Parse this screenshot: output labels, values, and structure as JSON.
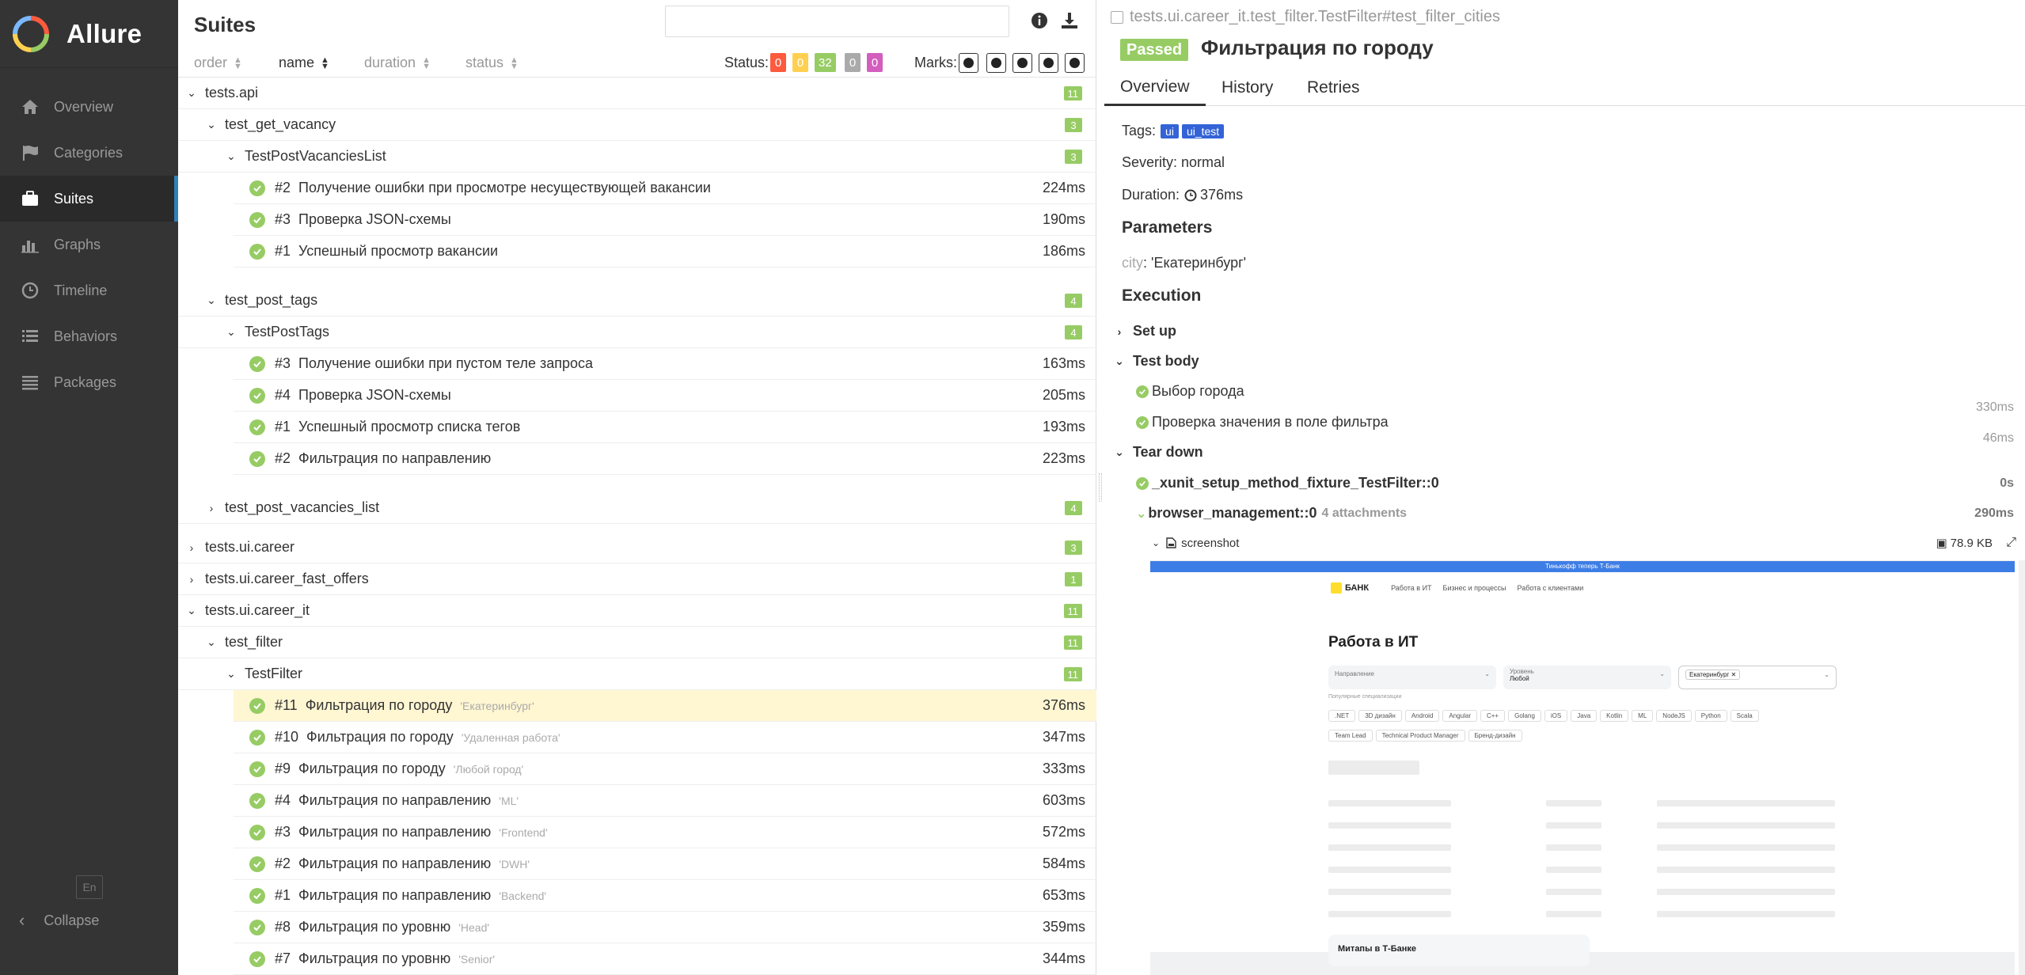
{
  "app": {
    "name": "Allure"
  },
  "sidebar": {
    "items": [
      {
        "label": "Overview",
        "icon": "home-icon"
      },
      {
        "label": "Categories",
        "icon": "flag-icon"
      },
      {
        "label": "Suites",
        "icon": "briefcase-icon",
        "active": true
      },
      {
        "label": "Graphs",
        "icon": "bar-chart-icon"
      },
      {
        "label": "Timeline",
        "icon": "clock-icon"
      },
      {
        "label": "Behaviors",
        "icon": "list-icon"
      },
      {
        "label": "Packages",
        "icon": "align-left-icon"
      }
    ],
    "lang": "En",
    "collapse": "Collapse"
  },
  "suites": {
    "title": "Suites",
    "sort": {
      "order": "order",
      "name": "name",
      "duration": "duration",
      "status": "status"
    },
    "status_label": "Status:",
    "status_counts": [
      {
        "value": "0",
        "color": "#fd5a3e"
      },
      {
        "value": "0",
        "color": "#ffd050"
      },
      {
        "value": "32",
        "color": "#97cc64"
      },
      {
        "value": "0",
        "color": "#aaaaaa"
      },
      {
        "value": "0",
        "color": "#d35ebe"
      }
    ],
    "marks_label": "Marks:",
    "rows": [
      {
        "level": 0,
        "chev": "v",
        "label": "tests.api",
        "count": "11"
      },
      {
        "level": 1,
        "chev": "v",
        "label": "test_get_vacancy",
        "count": "3"
      },
      {
        "level": 2,
        "chev": "v",
        "label": "TestPostVacanciesList",
        "count": "3"
      },
      {
        "level": 3,
        "num": "#2",
        "label": "Получение ошибки при просмотре несуществующей вакансии",
        "dur": "224ms"
      },
      {
        "level": 3,
        "num": "#3",
        "label": "Проверка JSON-схемы",
        "dur": "190ms"
      },
      {
        "level": 3,
        "num": "#1",
        "label": "Успешный просмотр вакансии",
        "dur": "186ms"
      },
      {
        "level": 1,
        "chev": "v",
        "label": "test_post_tags",
        "count": "4"
      },
      {
        "level": 2,
        "chev": "v",
        "label": "TestPostTags",
        "count": "4"
      },
      {
        "level": 3,
        "num": "#3",
        "label": "Получение ошибки при пустом теле запроса",
        "dur": "163ms"
      },
      {
        "level": 3,
        "num": "#4",
        "label": "Проверка JSON-схемы",
        "dur": "205ms"
      },
      {
        "level": 3,
        "num": "#1",
        "label": "Успешный просмотр списка тегов",
        "dur": "193ms"
      },
      {
        "level": 3,
        "num": "#2",
        "label": "Фильтрация по направлению",
        "dur": "223ms"
      },
      {
        "level": 1,
        "chev": ">",
        "label": "test_post_vacancies_list",
        "count": "4"
      },
      {
        "level": 0,
        "chev": ">",
        "label": "tests.ui.career",
        "count": "3"
      },
      {
        "level": 0,
        "chev": ">",
        "label": "tests.ui.career_fast_offers",
        "count": "1"
      },
      {
        "level": 0,
        "chev": "v",
        "label": "tests.ui.career_it",
        "count": "11"
      },
      {
        "level": 1,
        "chev": "v",
        "label": "test_filter",
        "count": "11"
      },
      {
        "level": 2,
        "chev": "v",
        "label": "TestFilter",
        "count": "11"
      },
      {
        "level": 3,
        "num": "#11",
        "label": "Фильтрация по городу",
        "param": "'Екатеринбург'",
        "dur": "376ms",
        "selected": true
      },
      {
        "level": 3,
        "num": "#10",
        "label": "Фильтрация по городу",
        "param": "'Удаленная работа'",
        "dur": "347ms"
      },
      {
        "level": 3,
        "num": "#9",
        "label": "Фильтрация по городу",
        "param": "'Любой город'",
        "dur": "333ms"
      },
      {
        "level": 3,
        "num": "#4",
        "label": "Фильтрация по направлению",
        "param": "'ML'",
        "dur": "603ms"
      },
      {
        "level": 3,
        "num": "#3",
        "label": "Фильтрация по направлению",
        "param": "'Frontend'",
        "dur": "572ms"
      },
      {
        "level": 3,
        "num": "#2",
        "label": "Фильтрация по направлению",
        "param": "'DWH'",
        "dur": "584ms"
      },
      {
        "level": 3,
        "num": "#1",
        "label": "Фильтрация по направлению",
        "param": "'Backend'",
        "dur": "653ms"
      },
      {
        "level": 3,
        "num": "#8",
        "label": "Фильтрация по уровню",
        "param": "'Head'",
        "dur": "359ms"
      },
      {
        "level": 3,
        "num": "#7",
        "label": "Фильтрация по уровню",
        "param": "'Senior'",
        "dur": "344ms"
      }
    ]
  },
  "detail": {
    "breadcrumb": "tests.ui.career_it.test_filter.TestFilter#test_filter_cities",
    "status": "Passed",
    "title": "Фильтрация по городу",
    "tabs": [
      "Overview",
      "History",
      "Retries"
    ],
    "tags_label": "Tags:",
    "tags": [
      "ui",
      "ui_test"
    ],
    "severity": "Severity: normal",
    "duration_label": "Duration:",
    "duration": "376ms",
    "parameters_title": "Parameters",
    "param_key": "city",
    "param_value": ": 'Екатеринбург'",
    "execution_title": "Execution",
    "setup": "Set up",
    "test_body": "Test body",
    "steps": [
      {
        "label": "Выбор города",
        "dur": "330ms"
      },
      {
        "label": "Проверка значения в поле фильтра",
        "dur": "46ms"
      }
    ],
    "teardown": "Tear down",
    "fixtures": [
      {
        "label": "_xunit_setup_method_fixture_TestFilter::0",
        "dur": "0s"
      },
      {
        "label": "browser_management::0",
        "note": "4 attachments",
        "dur": "290ms"
      }
    ],
    "attachment": {
      "name": "screenshot",
      "size": "78.9 KB"
    }
  },
  "preview": {
    "topbar": "Тинькофф теперь Т-Банк",
    "logo": "БАНК",
    "nav": [
      "Работа в ИТ",
      "Бизнес и процессы",
      "Работа с клиентами"
    ],
    "heading": "Работа в ИТ",
    "select1": "Направление",
    "select2_label": "Уровень",
    "select2_value": "Любой",
    "select3": "Екатеринбург",
    "popular": "Популярные специализации",
    "chips": [
      ".NET",
      "3D дизайн",
      "Android",
      "Angular",
      "C++",
      "Golang",
      "iOS",
      "Java",
      "Kotlin",
      "ML",
      "NodeJS",
      "Python",
      "Scala",
      "Team Lead",
      "Technical Product Manager",
      "Бренд-дизайн"
    ],
    "banner": "Митапы в Т-Банке"
  }
}
